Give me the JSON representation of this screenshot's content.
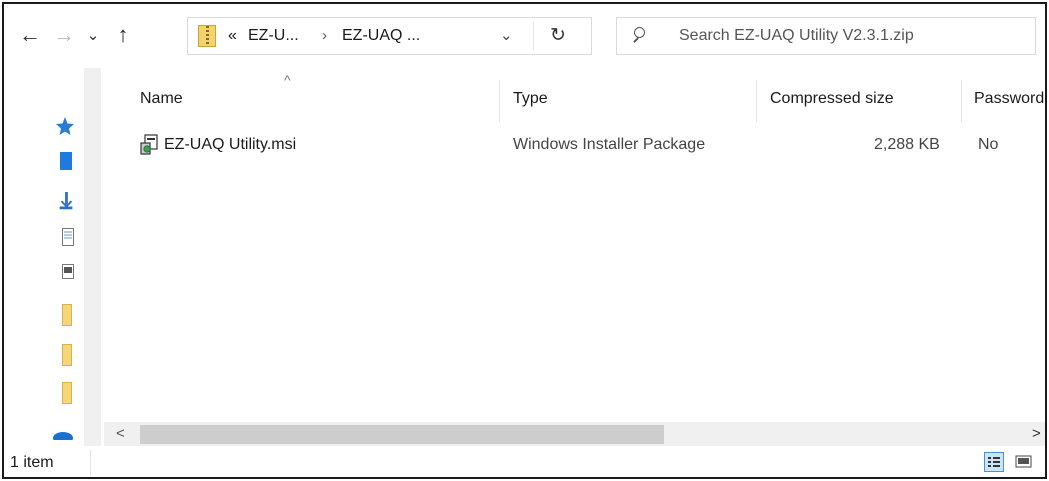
{
  "nav": {
    "back": "←",
    "forward": "→",
    "recent": "⌄",
    "up": "↑"
  },
  "address": {
    "overflow": "«",
    "crumbs": [
      "EZ-U...",
      "EZ-UAQ ..."
    ],
    "separator": "›",
    "dropdown": "⌄",
    "refresh": "↻"
  },
  "search": {
    "placeholder": "Search EZ-UAQ Utility V2.3.1.zip"
  },
  "columns": {
    "name": "Name",
    "type": "Type",
    "compressed_size": "Compressed size",
    "password": "Password"
  },
  "files": [
    {
      "name": "EZ-UAQ Utility.msi",
      "type": "Windows Installer Package",
      "compressed_size": "2,288 KB",
      "password": "No"
    }
  ],
  "status": {
    "item_count": "1 item"
  },
  "colors": {
    "accent": "#0078d7",
    "zip_folder": "#f4d36b",
    "scrollbar_thumb": "#cdcdcd"
  }
}
